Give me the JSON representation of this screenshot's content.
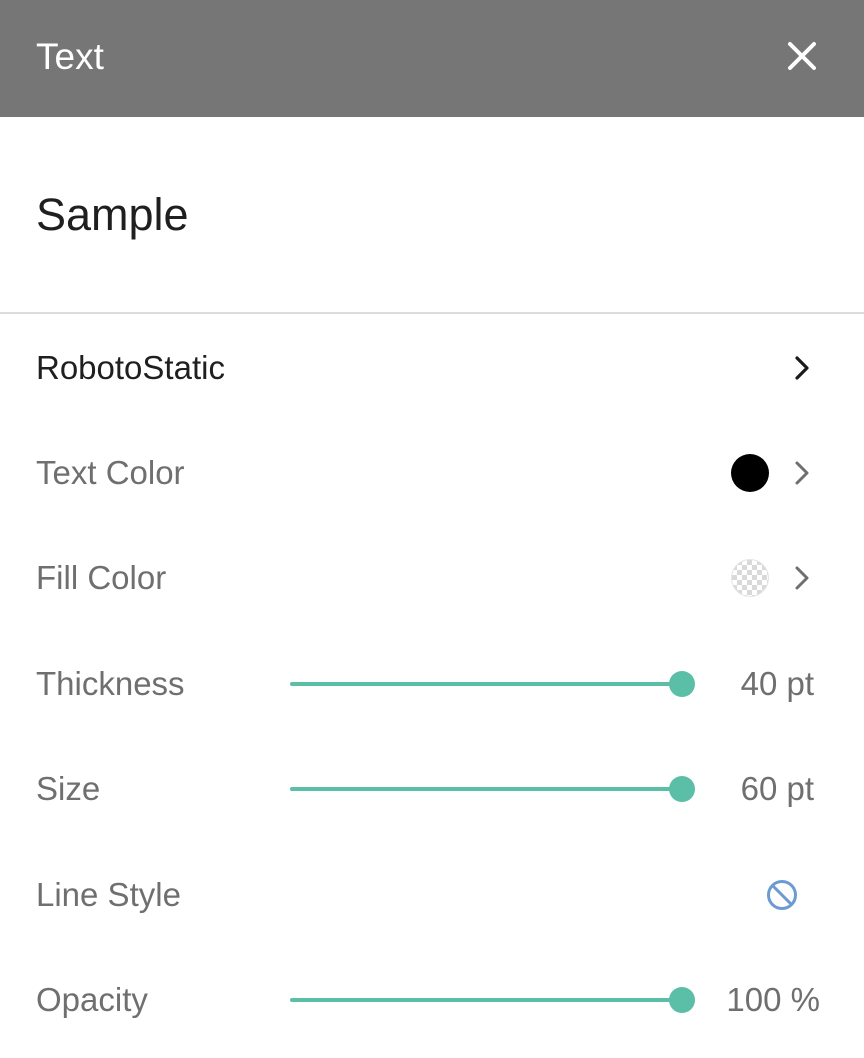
{
  "header": {
    "title": "Text",
    "close_icon": "close-icon",
    "background": "#767676"
  },
  "sample": {
    "text": "Sample"
  },
  "rows": {
    "font": {
      "label": "RobotoStatic",
      "icon": "chevron-right-icon"
    },
    "text_color": {
      "label": "Text Color",
      "color": "#000000",
      "icon": "chevron-right-icon"
    },
    "fill_color": {
      "label": "Fill Color",
      "color": "transparent",
      "icon": "chevron-right-icon"
    },
    "thickness": {
      "label": "Thickness",
      "value": "40 pt",
      "fraction": 0.96
    },
    "size": {
      "label": "Size",
      "value": "60 pt",
      "fraction": 0.96
    },
    "line_style": {
      "label": "Line Style",
      "icon": "no-line-style-icon"
    },
    "opacity": {
      "label": "Opacity",
      "value": "100 %",
      "fraction": 0.96
    }
  },
  "colors": {
    "accent": "#5bbfa7",
    "label_text": "#6f6f6f",
    "icon_blue": "#6b9bd1"
  }
}
